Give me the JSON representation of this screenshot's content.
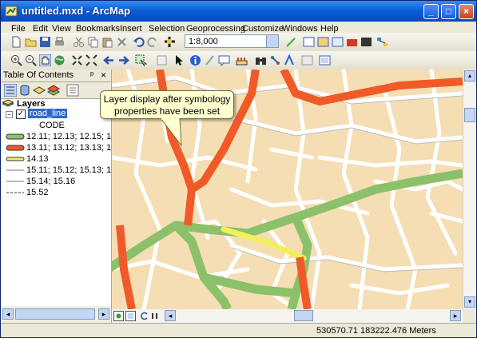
{
  "window": {
    "title": "untitled.mxd - ArcMap",
    "minimize": "_",
    "maximize": "□",
    "close": "×"
  },
  "menu": [
    "File",
    "Edit",
    "View",
    "Bookmarks",
    "Insert",
    "Selection",
    "Geoprocessing",
    "Customize",
    "Windows",
    "Help"
  ],
  "toolbar": {
    "scale": "1:8,000"
  },
  "toc": {
    "title": "Table Of Contents",
    "pin": "ᵖ",
    "close": "×",
    "layers_label": "Layers",
    "layer_name": "road_line",
    "field_name": "CODE",
    "legend": [
      {
        "label": "12.11; 12.13; 12.15; 1",
        "color": "#8cc06a",
        "style": "thick"
      },
      {
        "label": "13.11; 13.12; 13.13; 1",
        "color": "#f05a28",
        "style": "thick"
      },
      {
        "label": "14.13",
        "color": "#f2f05a",
        "style": "medium"
      },
      {
        "label": "15.11; 15.12; 15.13; 1",
        "color": "#7a7a7a",
        "style": "thin"
      },
      {
        "label": "15.14; 15.16",
        "color": "#7a7a7a",
        "style": "thin"
      },
      {
        "label": "15.52",
        "color": "#333333",
        "style": "dashed"
      }
    ]
  },
  "callout": {
    "line1": "Layer display after symbology",
    "line2": "properties have been set"
  },
  "status": {
    "coordinates": "530570.71  183222.476 Meters"
  },
  "colors": {
    "background": "#f5deb3",
    "green_road": "#8cc06a",
    "orange_road": "#f05a28",
    "yellow_road": "#f2f05a",
    "street": "#ffffff"
  }
}
